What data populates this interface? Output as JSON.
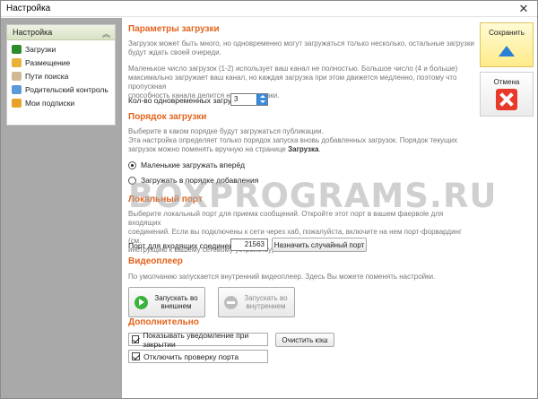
{
  "window": {
    "title": "Настройка",
    "close_glyph": "✕"
  },
  "sidebar": {
    "header": "Настройка",
    "collapse_glyph": "︽",
    "items": [
      {
        "label": "Загрузки",
        "icon": "download-arrow-icon",
        "color": "#2c8c2c"
      },
      {
        "label": "Размещение",
        "icon": "folder-icon",
        "color": "#e8b23a"
      },
      {
        "label": "Пути поиска",
        "icon": "search-paths-icon",
        "color": "#d0b894"
      },
      {
        "label": "Родительский контроль",
        "icon": "parental-control-icon",
        "color": "#5a9ad8"
      },
      {
        "label": "Мои подписки",
        "icon": "subscriptions-icon",
        "color": "#e6a22a"
      }
    ]
  },
  "downloads": {
    "heading": "Параметры загрузки",
    "text1_line1": "Загрузок может быть много, но одновременно могут загружаться только несколько, остальные загрузки",
    "text1_line2": "будут ждать своей очереди.",
    "text2_line1": "Маленькое число загрузок (1-2)  использует ваш канал не полностью. Большое число (4 и больше)",
    "text2_line2": "максимально загружает ваш канал, но каждая загрузка при этом движется медленно, поэтому что пропускная",
    "text2_line3": "способность канала делится на все загрузки.",
    "concurrent_label": "Кол-во одновременных загрузок",
    "concurrent_value": "3"
  },
  "order": {
    "heading": "Порядок загрузки",
    "text_line1": "Выберите в каком порядке будут загружаться публикации.",
    "text_line2": "Эта настройка определяет только порядок запуска вновь добавленных загрузок. Порядок текущих",
    "text_line3_prefix": "загрузок можно поменять вручную на странице ",
    "text_line3_bold": "Загрузка",
    "text_line3_suffix": ".",
    "option_small_first": "Маленькие загружать вперёд",
    "option_in_order": "Загружать в порядке добавления",
    "selected": "small_first"
  },
  "port": {
    "heading": "Локальный порт",
    "text_line1": "Выберите локальный порт для приема сообщений. Откройте этот порт в вашем фаервole для входящих",
    "text_line2": "соединений. Если вы подключены к сети через хаб, пожалуйста, включите на нем порт-форвардинг (см.",
    "text_line3": "инструкцию к вашему сетевому устройству).",
    "incoming_label": "Порт для входящих соединений",
    "port_value": "21563",
    "random_button": "Назначить случайный порт"
  },
  "video": {
    "heading": "Видеоплеер",
    "text": "По умолчанию запускается внутренний видеоплеер. Здесь Вы можете поменять настройки.",
    "external_line1": "Запускать во",
    "external_line2": "внешнем",
    "internal_line1": "Запускать во",
    "internal_line2": "внутреннем"
  },
  "extra": {
    "heading": "Дополнительно",
    "notify_label": "Показывать уведомление при закрытии",
    "notify_checked": true,
    "clear_cache": "Очистить кэш",
    "disable_port_check_label": "Отключить проверку порта",
    "disable_port_check_checked": true
  },
  "actions": {
    "save": "Сохранить",
    "cancel": "Отмена"
  },
  "watermark": "BOXPROGRAMS.RU"
}
